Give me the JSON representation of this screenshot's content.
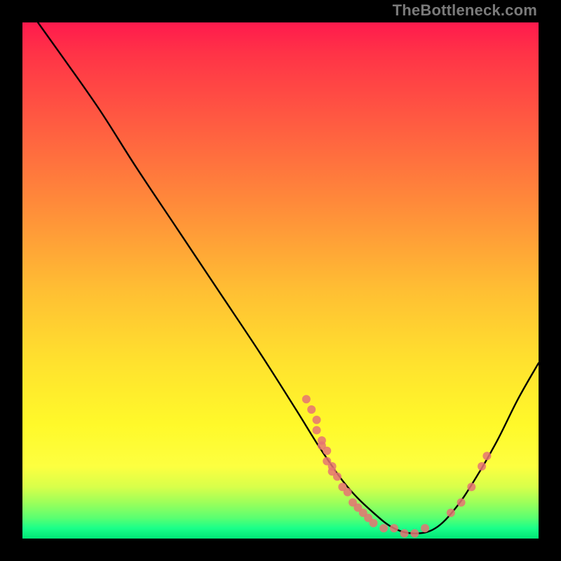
{
  "watermark": "TheBottleneck.com",
  "chart_data": {
    "type": "line",
    "title": "",
    "xlabel": "",
    "ylabel": "",
    "xlim": [
      0,
      100
    ],
    "ylim": [
      0,
      100
    ],
    "grid": false,
    "legend": false,
    "curve": [
      {
        "x": 3,
        "y": 100
      },
      {
        "x": 8,
        "y": 93
      },
      {
        "x": 15,
        "y": 83
      },
      {
        "x": 22,
        "y": 72
      },
      {
        "x": 30,
        "y": 60
      },
      {
        "x": 38,
        "y": 48
      },
      {
        "x": 46,
        "y": 36
      },
      {
        "x": 53,
        "y": 25
      },
      {
        "x": 58,
        "y": 17
      },
      {
        "x": 63,
        "y": 10
      },
      {
        "x": 68,
        "y": 5
      },
      {
        "x": 72,
        "y": 2
      },
      {
        "x": 76,
        "y": 1
      },
      {
        "x": 80,
        "y": 2
      },
      {
        "x": 84,
        "y": 6
      },
      {
        "x": 88,
        "y": 12
      },
      {
        "x": 92,
        "y": 19
      },
      {
        "x": 96,
        "y": 27
      },
      {
        "x": 100,
        "y": 34
      }
    ],
    "dots": [
      {
        "x": 55,
        "y": 27
      },
      {
        "x": 56,
        "y": 25
      },
      {
        "x": 57,
        "y": 23
      },
      {
        "x": 57,
        "y": 21
      },
      {
        "x": 58,
        "y": 19
      },
      {
        "x": 58,
        "y": 18
      },
      {
        "x": 59,
        "y": 17
      },
      {
        "x": 59,
        "y": 15
      },
      {
        "x": 60,
        "y": 14
      },
      {
        "x": 60,
        "y": 13
      },
      {
        "x": 61,
        "y": 12
      },
      {
        "x": 62,
        "y": 10
      },
      {
        "x": 63,
        "y": 9
      },
      {
        "x": 64,
        "y": 7
      },
      {
        "x": 65,
        "y": 6
      },
      {
        "x": 66,
        "y": 5
      },
      {
        "x": 67,
        "y": 4
      },
      {
        "x": 68,
        "y": 3
      },
      {
        "x": 70,
        "y": 2
      },
      {
        "x": 72,
        "y": 2
      },
      {
        "x": 74,
        "y": 1
      },
      {
        "x": 76,
        "y": 1
      },
      {
        "x": 78,
        "y": 2
      },
      {
        "x": 83,
        "y": 5
      },
      {
        "x": 85,
        "y": 7
      },
      {
        "x": 87,
        "y": 10
      },
      {
        "x": 89,
        "y": 14
      },
      {
        "x": 90,
        "y": 16
      }
    ],
    "colors": {
      "line": "#000000",
      "dot": "#e57373",
      "gradient_top": "#ff1a4d",
      "gradient_mid": "#ffe22e",
      "gradient_bottom": "#00e676",
      "frame": "#000000"
    }
  }
}
